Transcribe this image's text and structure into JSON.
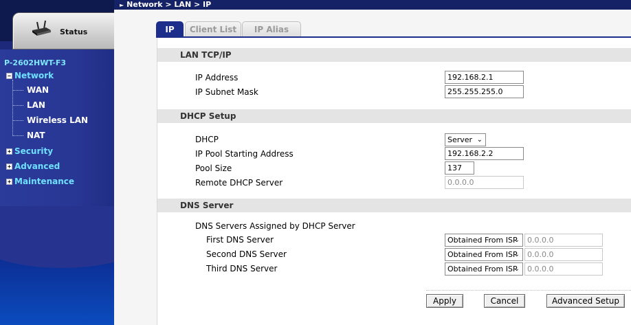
{
  "sidebar": {
    "status_label": "Status",
    "device_name": "P-2602HWT-F3",
    "network": {
      "label": "Network",
      "expander": "−"
    },
    "sub_items": [
      "WAN",
      "LAN",
      "Wireless LAN",
      "NAT"
    ],
    "security": {
      "label": "Security",
      "expander": "+"
    },
    "advanced": {
      "label": "Advanced",
      "expander": "+"
    },
    "maintenance": {
      "label": "Maintenance",
      "expander": "+"
    }
  },
  "breadcrumb": "Network > LAN > IP",
  "tabs": [
    "IP",
    "Client List",
    "IP Alias"
  ],
  "lan_tcpip": {
    "title": "LAN TCP/IP",
    "ip_address_label": "IP Address",
    "ip_address_value": "192.168.2.1",
    "subnet_label": "IP Subnet Mask",
    "subnet_value": "255.255.255.0"
  },
  "dhcp": {
    "title": "DHCP Setup",
    "dhcp_label": "DHCP",
    "dhcp_value": "Server",
    "pool_start_label": "IP Pool Starting Address",
    "pool_start_value": "192.168.2.2",
    "pool_size_label": "Pool Size",
    "pool_size_value": "137",
    "remote_label": "Remote DHCP Server",
    "remote_value": "0.0.0.0"
  },
  "dns": {
    "title": "DNS Server",
    "assigned_label": "DNS Servers Assigned by DHCP Server",
    "servers": [
      {
        "label": "First DNS Server",
        "mode": "Obtained From ISP",
        "value": "0.0.0.0"
      },
      {
        "label": "Second DNS Server",
        "mode": "Obtained From ISP",
        "value": "0.0.0.0"
      },
      {
        "label": "Third DNS Server",
        "mode": "Obtained From ISP",
        "value": "0.0.0.0"
      }
    ]
  },
  "buttons": {
    "apply": "Apply",
    "cancel": "Cancel",
    "advanced_setup": "Advanced Setup"
  },
  "colors": {
    "sidebar_bg": "#1d2a7c",
    "nav_text": "#6fe0ff",
    "tab_active": "#1d2d8c",
    "section_bg": "#e4e4e4"
  }
}
